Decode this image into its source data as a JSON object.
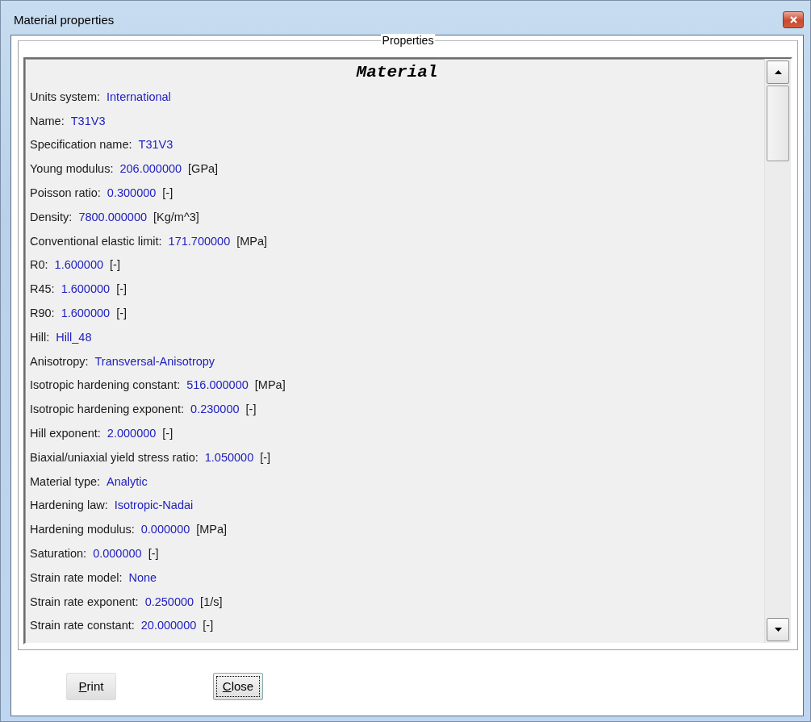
{
  "window": {
    "title": "Material properties"
  },
  "group": {
    "title": "Properties"
  },
  "list": {
    "heading": "Material",
    "rows": [
      {
        "label": "Units system:",
        "value": "International"
      },
      {
        "label": "Name:",
        "value": "T31V3"
      },
      {
        "label": "Specification name:",
        "value": "T31V3"
      },
      {
        "label": "Young modulus:",
        "value": "206.000000",
        "unit": "[GPa]"
      },
      {
        "label": "Poisson ratio:",
        "value": "0.300000",
        "unit": "[-]"
      },
      {
        "label": "Density:",
        "value": "7800.000000",
        "unit": "[Kg/m^3]"
      },
      {
        "label": "Conventional elastic limit:",
        "value": "171.700000",
        "unit": "[MPa]"
      },
      {
        "label": "R0:",
        "value": "1.600000",
        "unit": "[-]"
      },
      {
        "label": "R45:",
        "value": "1.600000",
        "unit": "[-]"
      },
      {
        "label": "R90:",
        "value": "1.600000",
        "unit": "[-]"
      },
      {
        "label": "Hill:",
        "value": "Hill_48"
      },
      {
        "label": "Anisotropy:",
        "value": "Transversal-Anisotropy"
      },
      {
        "label": "Isotropic hardening constant:",
        "value": "516.000000",
        "unit": "[MPa]"
      },
      {
        "label": "Isotropic hardening exponent:",
        "value": "0.230000",
        "unit": "[-]"
      },
      {
        "label": "Hill exponent:",
        "value": "2.000000",
        "unit": "[-]"
      },
      {
        "label": "Biaxial/uniaxial yield stress ratio:",
        "value": "1.050000",
        "unit": "[-]"
      },
      {
        "label": "Material type:",
        "value": "Analytic"
      },
      {
        "label": "Hardening law:",
        "value": "Isotropic-Nadai"
      },
      {
        "label": "Hardening modulus:",
        "value": "0.000000",
        "unit": "[MPa]"
      },
      {
        "label": "Saturation:",
        "value": "0.000000",
        "unit": "[-]"
      },
      {
        "label": "Strain rate model:",
        "value": "None"
      },
      {
        "label": "Strain rate exponent:",
        "value": "0.250000",
        "unit": "[1/s]"
      },
      {
        "label": "Strain rate constant:",
        "value": "20.000000",
        "unit": "[-]"
      }
    ]
  },
  "buttons": [
    {
      "label": "Print",
      "focused": false
    },
    {
      "label": "Close",
      "focused": true
    }
  ]
}
